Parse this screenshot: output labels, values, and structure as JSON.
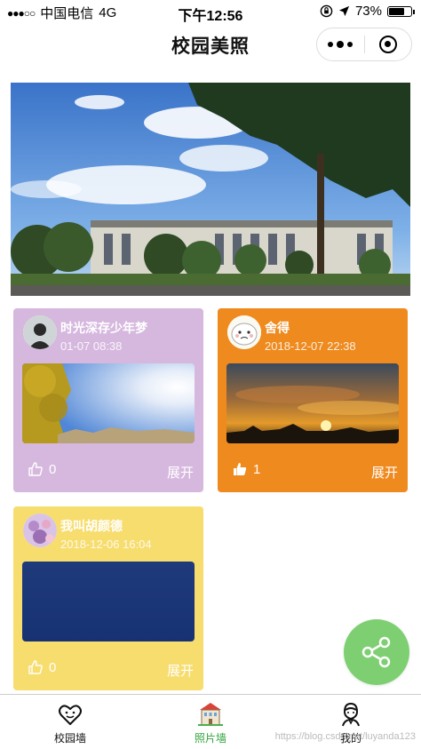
{
  "status_bar": {
    "signal": "●●●○○",
    "carrier": "中国电信",
    "network": "4G",
    "time": "下午12:56",
    "battery": "73%",
    "battery_level": 0.73
  },
  "nav": {
    "title": "校园美照"
  },
  "cards": [
    {
      "name": "时光深存少年梦",
      "time": "01-07 08:38",
      "likes": "0",
      "expand": "展开",
      "color": "#d6b8df",
      "like_icon": "thumb-outline"
    },
    {
      "name": "舍得",
      "time": "2018-12-07 22:38",
      "likes": "1",
      "expand": "展开",
      "color": "#ef8a1e",
      "like_icon": "thumb-filled"
    },
    {
      "name": "我叫胡颜德",
      "time": "2018-12-06 16:04",
      "likes": "0",
      "expand": "展开",
      "color": "#f7dd6e",
      "like_icon": "thumb-outline"
    }
  ],
  "fab": {
    "icon": "share-icon",
    "color": "#7ecf72"
  },
  "tabs": [
    {
      "label": "校园墙",
      "icon": "heart-face-icon",
      "active": false
    },
    {
      "label": "照片墙",
      "icon": "building-icon",
      "active": true
    },
    {
      "label": "我的",
      "icon": "person-icon",
      "active": false
    }
  ],
  "watermark": "https://blog.csdn.net/luyanda123"
}
